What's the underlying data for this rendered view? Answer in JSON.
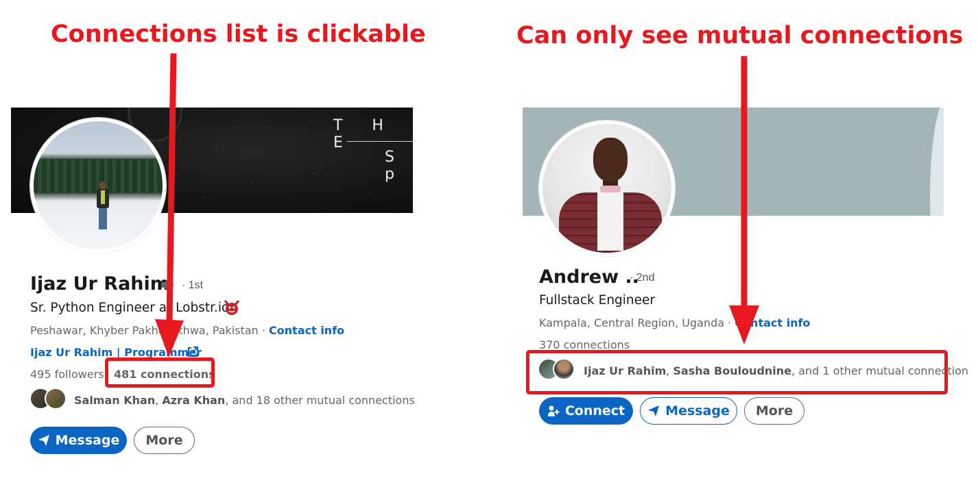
{
  "annotations": {
    "left_title": "Connections list is clickable",
    "right_title": "Can only see mutual connections"
  },
  "colors": {
    "annotation_red": "#e8191e",
    "linkedin_blue": "#0a66c2"
  },
  "left_profile": {
    "cover": {
      "line1": "T H E",
      "line2": "S p"
    },
    "name": "Ijaz Ur Rahim",
    "degree": "· 1st",
    "headline": "Sr. Python Engineer at Lobstr.io",
    "location": "Peshawar, Khyber Pakhtunkhwa, Pakistan",
    "location_sep": " · ",
    "contact_info": "Contact info",
    "website": "Ijaz Ur Rahim | Programmer",
    "followers": "495 followers",
    "connections": "481 connections",
    "mutual": {
      "name1": "Salman Khan",
      "sep": ", ",
      "name2": "Azra Khan",
      "rest": ", and 18 other mutual connections"
    },
    "buttons": {
      "message": "Message",
      "more": "More"
    },
    "icons": {
      "speaker": "speaker-icon",
      "badge": "devil-emoji-icon",
      "external": "external-link-icon",
      "send": "send-icon"
    }
  },
  "right_profile": {
    "name": "Andrew ..",
    "degree": "· 2nd",
    "headline": "Fullstack Engineer",
    "location": "Kampala, Central Region, Uganda",
    "location_sep": " · ",
    "contact_info": "Contact info",
    "connections": "370 connections",
    "mutual": {
      "name1": "Ijaz Ur Rahim",
      "sep": ", ",
      "name2": "Sasha Bouloudnine",
      "rest": ", and 1 other mutual connection"
    },
    "buttons": {
      "connect": "Connect",
      "message": "Message",
      "more": "More"
    },
    "icons": {
      "connect": "add-person-icon",
      "send": "send-icon"
    }
  }
}
